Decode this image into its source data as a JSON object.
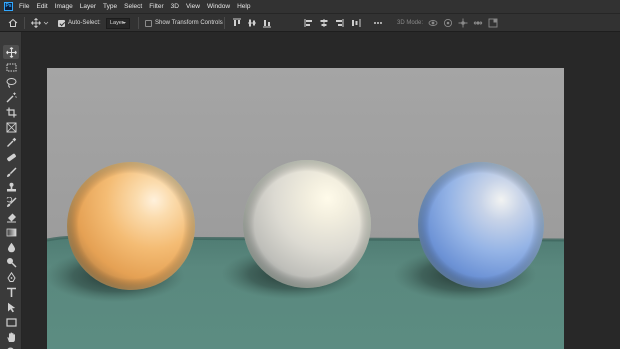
{
  "app": {
    "logo_text": "Ps"
  },
  "menu": [
    "File",
    "Edit",
    "Image",
    "Layer",
    "Type",
    "Select",
    "Filter",
    "3D",
    "View",
    "Window",
    "Help"
  ],
  "options_bar": {
    "auto_select_label": "Auto-Select:",
    "auto_select_checked": true,
    "auto_select_target": "Layer",
    "show_transform_label": "Show Transform Controls",
    "show_transform_checked": false,
    "mode_3d_label": "3D Mode:"
  },
  "tools": [
    "move-tool",
    "marquee-tool",
    "lasso-tool",
    "magic-wand-tool",
    "crop-tool",
    "frame-tool",
    "eyedropper-tool",
    "healing-brush-tool",
    "brush-tool",
    "clone-stamp-tool",
    "history-brush-tool",
    "eraser-tool",
    "gradient-tool",
    "blur-tool",
    "dodge-tool",
    "pen-tool",
    "type-tool",
    "path-selection-tool",
    "rectangle-tool",
    "hand-tool",
    "zoom-tool"
  ],
  "active_tool": "move-tool",
  "canvas": {
    "colors": {
      "wall": "#a7a7a7",
      "table": "#5b8a80",
      "sphere_orange": "#f2b66a",
      "sphere_white": "#e3e1d8",
      "sphere_blue": "#8fb2e8"
    }
  }
}
